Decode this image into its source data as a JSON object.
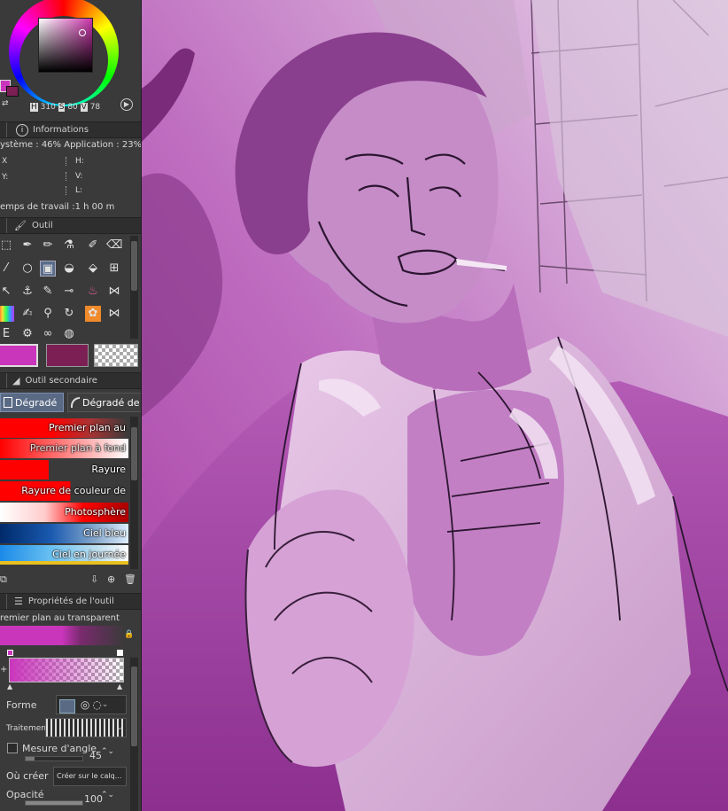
{
  "color": {
    "h_value": "310",
    "s_value": "80",
    "v_value": "78",
    "foreground": "#c935bb",
    "background": "#7b1f54"
  },
  "info_panel": {
    "title": "Informations",
    "memory": "ystème : 46% Application :  23%",
    "x_label": "X",
    "y_label": "Y:",
    "h_label": "H:",
    "v_label": "V:",
    "l_label": "L:",
    "worktime": "emps de travail :1 h 00 m"
  },
  "tool_panel": {
    "title": "Outil"
  },
  "subtool_panel": {
    "title": "Outil secondaire",
    "tabs": [
      "Dégradé",
      "Dégradé de"
    ],
    "gradients": [
      "Premier plan au transparent",
      "Premier plan à fond",
      "Rayure",
      "Rayure de couleur de fond",
      "Photosphère",
      "Ciel bleu",
      "Ciel en journée"
    ]
  },
  "properties_panel": {
    "title": "Propriétés de l'outil",
    "preset_name": "remier plan au transparent",
    "forme_label": "Forme",
    "traitement_label": "Traitement",
    "angle_label": "Mesure d'angle",
    "angle_value": "45",
    "create_label": "Où créer",
    "create_value": "Créer sur le calq...",
    "opacity_label": "Opacité",
    "opacity_value": "100"
  }
}
